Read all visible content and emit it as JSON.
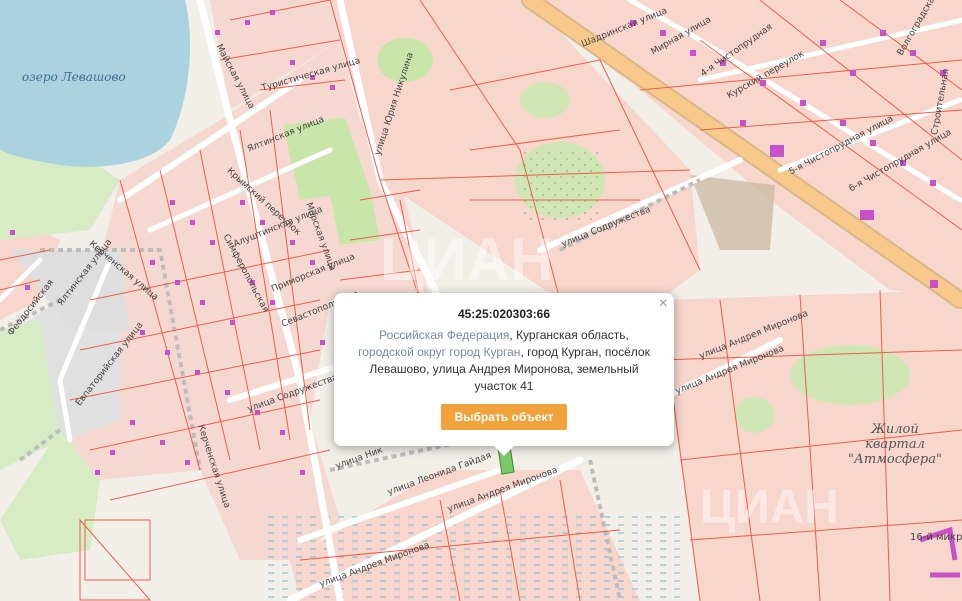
{
  "map": {
    "lake_label": "озеро Левашово",
    "quarter_label_line1": "Жилой",
    "quarter_label_line2": "квартал",
    "quarter_label_line3": "\"Атмосфера\"",
    "corner_label": "16-й микро",
    "street_labels": {
      "maiskaya": "Майская улица",
      "turisticheskaya": "Туристическая улица",
      "yalтinskaya_n": "Ялтинская улица",
      "kryimskiy": "Крымский переулок",
      "simferopolskaya": "Симферопольская",
      "alushtinskaya": "Алуштинская улица",
      "morskaya": "Морская улица",
      "yuriya_nikulina": "улица Юрия Никулина",
      "kerchenskaya_w": "Керченская улица",
      "yaltinskaya_w": "Ялтинская улица",
      "feodosiyskaya": "Феодосийская",
      "evpatoriyskaya": "Евпаторийская улица",
      "primorskaya": "Приморская улица",
      "sevastopolskaya": "Севастопольская",
      "sodruzhestva_w": "улица Содружества",
      "kerchenskaya_s": "Керченская улица",
      "sodruzhestva_e": "улица Содружества",
      "mironova_e": "улица Андрея Миронова",
      "mironova_e2": "улица Андрея Миронова",
      "mironova_s": "улица Андрея Миронова",
      "mironova_sw": "улица Андрея Миронова",
      "leonida": "улица Леонида Гайдая",
      "nikulina_s": "улица Ник",
      "shadrinskaya": "Шадринская улица",
      "mirnaya": "Мирная улица",
      "chistoprudnaya": "4-я Чистопрудная",
      "kurskiy": "Курский переулок",
      "chistoprudnaya5": "5-я Чистопрудная улица",
      "volgogradskaya": "Волгоградская",
      "stroitelnaya": "Строительная",
      "chistoprudnaya6": "6-я Чистопрудная улица"
    }
  },
  "watermarks": {
    "center": "ЦИАН",
    "right": "ЦИАН"
  },
  "popup": {
    "cadastral_number": "45:25:020303:66",
    "addr_part1": "Российская Федерация",
    "addr_sep1": ", ",
    "addr_part2": "Курганская область",
    "addr_sep2": ",",
    "addr_part3": "городской округ город Курган",
    "addr_sep3": ", ",
    "addr_part4": "город Курган",
    "addr_part5": ", посёлок Левашово, улица Андрея Миронова, земельный участок 41",
    "select_button": "Выбрать объект",
    "close_glyph": "×"
  },
  "colors": {
    "parcel_line": "#e8604a",
    "parcel_fill": "#f7d6cc",
    "water": "#aad3df",
    "park": "#c8e6a9",
    "building": "#c850c8",
    "road_major": "#f7c98b",
    "button": "#f0a23b"
  }
}
